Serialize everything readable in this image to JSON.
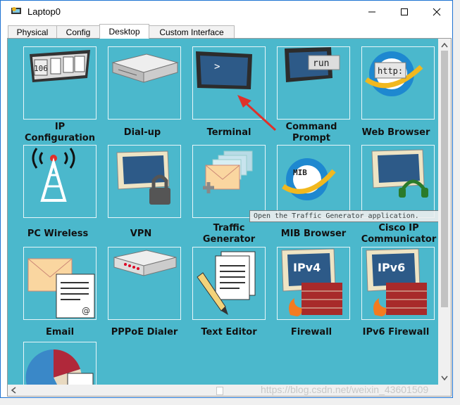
{
  "window": {
    "title": "Laptop0"
  },
  "tabs": [
    {
      "label": "Physical"
    },
    {
      "label": "Config"
    },
    {
      "label": "Desktop"
    },
    {
      "label": "Custom Interface"
    }
  ],
  "active_tab": "Desktop",
  "apps": [
    {
      "label": "IP\nConfiguration",
      "icon": "ip-configuration-icon"
    },
    {
      "label": "Dial-up",
      "icon": "dial-up-icon"
    },
    {
      "label": "Terminal",
      "icon": "terminal-icon"
    },
    {
      "label": "Command\nPrompt",
      "icon": "command-prompt-icon"
    },
    {
      "label": "Web Browser",
      "icon": "web-browser-icon"
    },
    {
      "label": "PC Wireless",
      "icon": "pc-wireless-icon"
    },
    {
      "label": "VPN",
      "icon": "vpn-icon"
    },
    {
      "label": "Traffic\nGenerator",
      "icon": "traffic-generator-icon"
    },
    {
      "label": "MIB Browser",
      "icon": "mib-browser-icon"
    },
    {
      "label": "Cisco IP\nCommunicator",
      "icon": "cisco-ip-communicator-icon"
    },
    {
      "label": "Email",
      "icon": "email-icon"
    },
    {
      "label": "PPPoE Dialer",
      "icon": "pppoe-dialer-icon"
    },
    {
      "label": "Text Editor",
      "icon": "text-editor-icon"
    },
    {
      "label": "Firewall",
      "icon": "firewall-icon"
    },
    {
      "label": "IPv6 Firewall",
      "icon": "ipv6-firewall-icon"
    },
    {
      "label": "",
      "icon": "chart-app-icon"
    }
  ],
  "icon_text": {
    "ip_config_number": "106",
    "command_prompt": "run",
    "web_browser": "http:",
    "mib": "MIB",
    "terminal": ">",
    "ipv4": "IPv4",
    "ipv6": "IPv6"
  },
  "tooltip": "Open the Traffic Generator application.",
  "watermark": "https://blog.csdn.net/weixin_43601509",
  "colors": {
    "desktop_bg": "#4bb8cc",
    "accent_arrow": "#e0302a"
  }
}
